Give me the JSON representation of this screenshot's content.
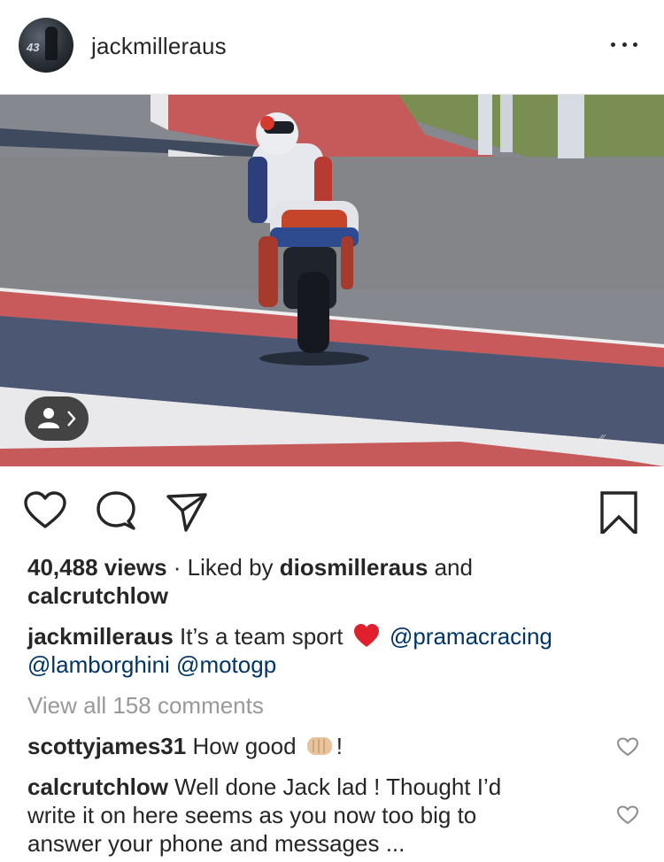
{
  "post": {
    "username": "jackmilleraus",
    "views": "40,488 views",
    "liked_by_prefix": " · Liked by ",
    "liked_by_user1": "diosmilleraus",
    "liked_by_and": " and",
    "liked_by_user2": "calcrutchlow",
    "caption": {
      "user": "jackmilleraus",
      "text": " It’s a team sport ",
      "mention1": "@pramacracing",
      "mention2": "@lamborghini",
      "mention3": "@motogp"
    },
    "view_all": "View all 158 comments"
  },
  "comments": [
    {
      "user": "scottyjames31",
      "text_before": " How good ",
      "text_after": "!"
    },
    {
      "user": "calcrutchlow",
      "line1": " Well done Jack lad ! Thought I’d",
      "line2": "write it on here seems as you now too big to",
      "line3": "answer your phone and messages ..."
    }
  ],
  "avatar_number": "43",
  "icons": {
    "more": "more-options-icon",
    "tag": "tagged-people-icon",
    "like": "heart-icon",
    "comment": "comment-icon",
    "share": "share-icon",
    "save": "bookmark-icon",
    "heart_emoji": "red-heart-emoji",
    "fist_emoji": "fist-bump-emoji",
    "comment_like": "small-heart-icon"
  },
  "colors": {
    "text": "#262626",
    "link": "#003569",
    "muted": "#999999",
    "heart_emoji": "#e0202c"
  }
}
